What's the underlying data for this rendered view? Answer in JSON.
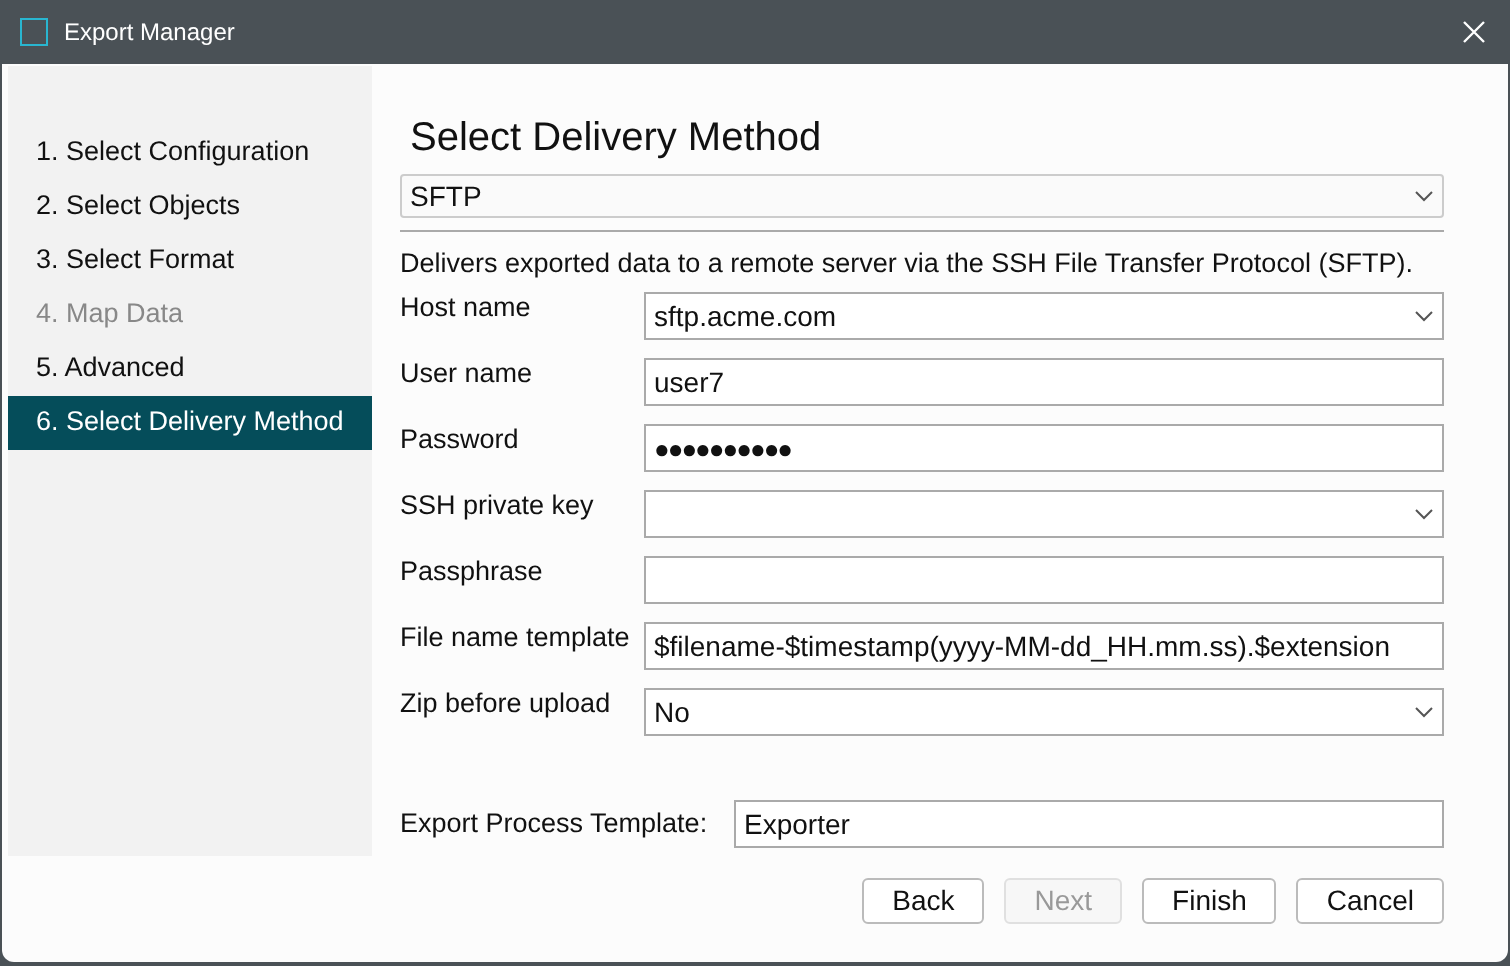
{
  "window": {
    "title": "Export Manager"
  },
  "steps": [
    {
      "label": "1. Select Configuration",
      "selected": false,
      "disabled": false
    },
    {
      "label": "2. Select Objects",
      "selected": false,
      "disabled": false
    },
    {
      "label": "3. Select Format",
      "selected": false,
      "disabled": false
    },
    {
      "label": "4. Map Data",
      "selected": false,
      "disabled": true
    },
    {
      "label": "5. Advanced",
      "selected": false,
      "disabled": false
    },
    {
      "label": "6. Select Delivery Method",
      "selected": true,
      "disabled": false
    }
  ],
  "heading": "Select Delivery Method",
  "method": {
    "value": "SFTP"
  },
  "description": "Delivers exported data to a remote server via the SSH File Transfer Protocol (SFTP).",
  "fields": [
    {
      "label": "Host name",
      "kind": "dropdown",
      "value": "sftp.acme.com"
    },
    {
      "label": "User name",
      "kind": "text",
      "value": "user7"
    },
    {
      "label": "Password",
      "kind": "password",
      "value": "●●●●●●●●●●"
    },
    {
      "label": "SSH private key",
      "kind": "dropdown"
    },
    {
      "label": "Passphrase",
      "kind": "text"
    },
    {
      "label": "File name template",
      "kind": "text",
      "value": "$filename-$timestamp(yyyy-MM-dd_HH.mm.ss).$extension"
    },
    {
      "label": "Zip before upload",
      "kind": "dropdown",
      "value": "No"
    }
  ],
  "process_template": {
    "label": "Export Process Template:",
    "value": "Exporter"
  },
  "buttons": [
    {
      "label": "Back",
      "disabled": false
    },
    {
      "label": "Next",
      "disabled": true
    },
    {
      "label": "Finish",
      "disabled": false
    },
    {
      "label": "Cancel",
      "disabled": false
    }
  ]
}
